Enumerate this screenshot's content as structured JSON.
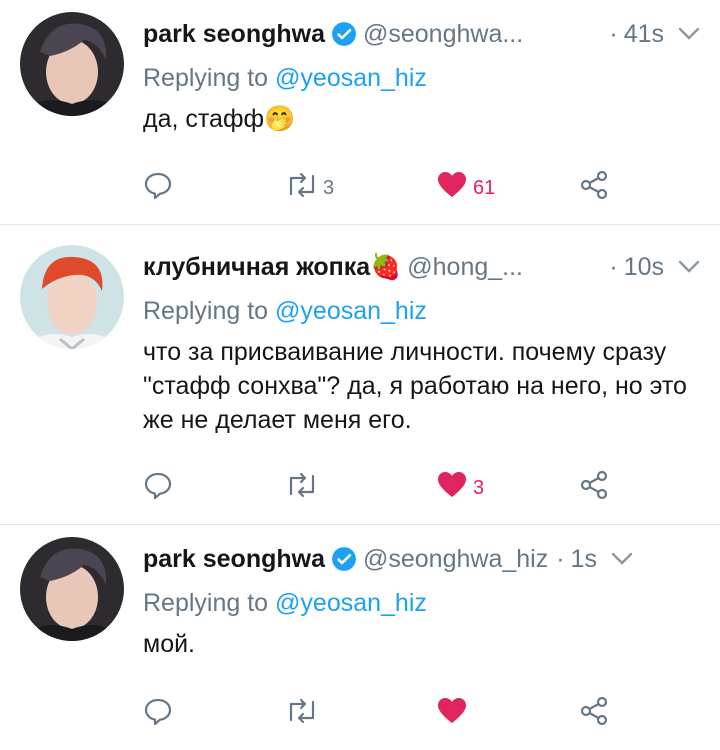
{
  "tweets": [
    {
      "name": "park seonghwa",
      "verified": true,
      "handle": "@seonghwa...",
      "dot": "·",
      "time": "41s",
      "replying_prefix": "Replying to ",
      "replying_to": "@yeosan_hiz",
      "text": "да, стафф🤭",
      "retweets": "3",
      "likes": "61",
      "liked": true
    },
    {
      "name": "клубничная жопка🍓",
      "verified": false,
      "handle": "@hong_...",
      "dot": "·",
      "time": "10s",
      "replying_prefix": "Replying to ",
      "replying_to": "@yeosan_hiz",
      "text": "что за присваивание личности. почему сразу \"стафф сонхва\"? да, я работаю на него, но это же не делает меня его.",
      "retweets": "",
      "likes": "3",
      "liked": true
    },
    {
      "name": "park seonghwa",
      "verified": true,
      "handle": "@seonghwa_hiz",
      "dot": "·",
      "time": "1s",
      "replying_prefix": "Replying to ",
      "replying_to": "@yeosan_hiz",
      "text": "мой.",
      "retweets": "",
      "likes": "",
      "liked": true
    }
  ],
  "colors": {
    "accent": "#1da1f2",
    "like": "#e0245e",
    "muted": "#657786",
    "divider": "#e1e8ed"
  },
  "icons": [
    "reply-icon",
    "retweet-icon",
    "heart-icon",
    "share-icon",
    "verified-badge-icon",
    "chevron-down-icon"
  ]
}
